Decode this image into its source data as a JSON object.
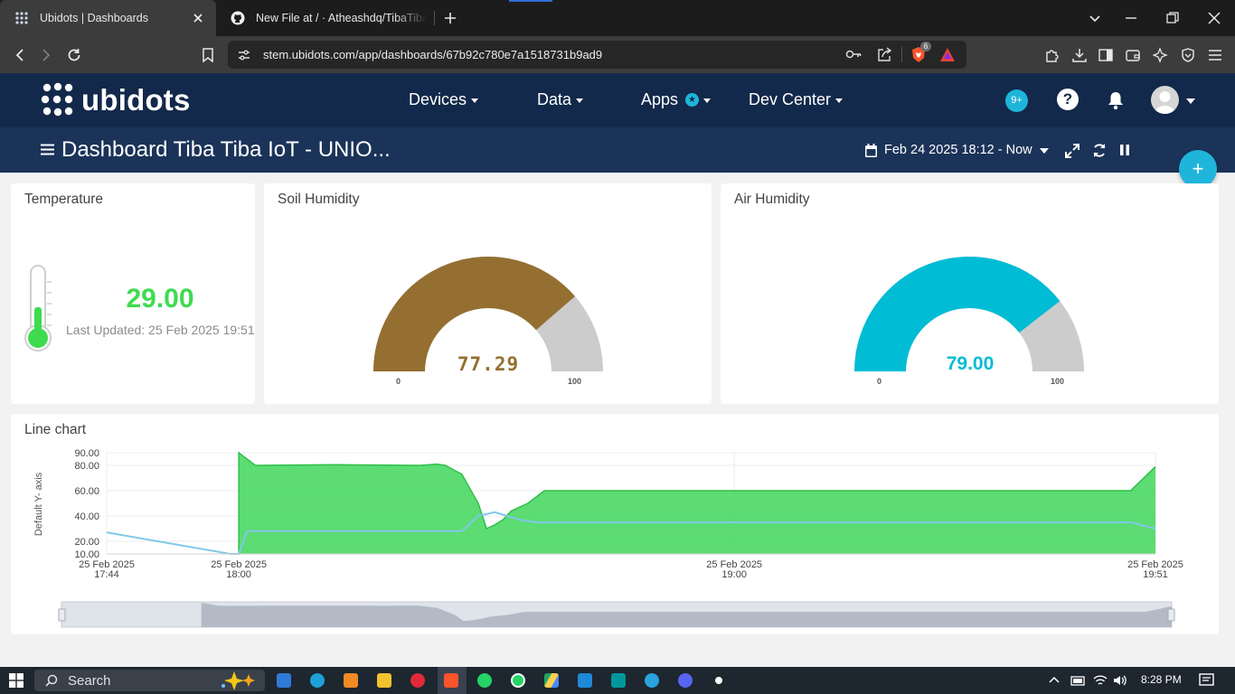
{
  "browser": {
    "tabs": [
      {
        "title": "Ubidots | Dashboards",
        "active": true
      },
      {
        "title": "New File at / · Atheashdq/TibaTibaIoT",
        "active": false
      }
    ],
    "url": "stem.ubidots.com/app/dashboards/67b92c780e7a1518731b9ad9",
    "extension_badge": "6"
  },
  "nav": {
    "logo": "ubidots",
    "items": [
      {
        "label": "Devices"
      },
      {
        "label": "Data"
      },
      {
        "label": "Apps"
      },
      {
        "label": "Dev Center"
      }
    ],
    "notifications_badge": "9+",
    "help": "?"
  },
  "dashboard": {
    "title": "Dashboard Tiba Tiba IoT - UNIO...",
    "date_range": "Feb 24 2025 18:12 - Now",
    "add_button": "+"
  },
  "widgets": {
    "temperature": {
      "title": "Temperature",
      "value": "29.00",
      "last_updated": "Last Updated: 25 Feb 2025 19:51",
      "color": "#3fdb4f"
    },
    "soil": {
      "title": "Soil Humidity",
      "value": "77.29",
      "min": "0",
      "max": "100",
      "level": 77.29,
      "color": "#946f31"
    },
    "air": {
      "title": "Air Humidity",
      "value": "79.00",
      "min": "0",
      "max": "100",
      "level": 79,
      "color": "#00bcd4"
    },
    "line": {
      "title": "Line chart"
    }
  },
  "chart_data": {
    "type": "area",
    "title": "Line chart",
    "ylabel": "Default Y- axis",
    "ylim": [
      10,
      90
    ],
    "yticks": [
      "90.00",
      "80.00",
      "60.00",
      "40.00",
      "20.00",
      "10.00"
    ],
    "xticks": [
      {
        "l1": "25 Feb 2025",
        "l2": "17:44",
        "t": "17:44"
      },
      {
        "l1": "25 Feb 2025",
        "l2": "18:00",
        "t": "18:00"
      },
      {
        "l1": "25 Feb 2025",
        "l2": "19:00",
        "t": "19:00"
      },
      {
        "l1": "25 Feb 2025",
        "l2": "19:51",
        "t": "19:51"
      }
    ],
    "series": [
      {
        "color": "#3fd65a",
        "fill": true,
        "points": [
          [
            "18:00",
            10
          ],
          [
            "18:00",
            90
          ],
          [
            "18:02",
            80
          ],
          [
            "18:12",
            80.5
          ],
          [
            "18:22",
            80
          ],
          [
            "18:24",
            81
          ],
          [
            "18:25",
            80
          ],
          [
            "18:27",
            73
          ],
          [
            "18:29",
            50
          ],
          [
            "18:30",
            30
          ],
          [
            "18:31",
            33
          ],
          [
            "18:32",
            37
          ],
          [
            "18:33",
            44
          ],
          [
            "18:35",
            50
          ],
          [
            "18:37",
            60
          ],
          [
            "19:48",
            60
          ],
          [
            "19:51",
            79
          ]
        ]
      },
      {
        "color": "#80c8e8",
        "fill": false,
        "points": [
          [
            "17:44",
            27
          ],
          [
            "17:59",
            10
          ],
          [
            "18:00",
            10
          ],
          [
            "18:01",
            28
          ],
          [
            "18:27",
            28
          ],
          [
            "18:29",
            40
          ],
          [
            "18:31",
            43
          ],
          [
            "18:34",
            37
          ],
          [
            "18:36",
            35
          ],
          [
            "19:48",
            35
          ],
          [
            "19:51",
            30
          ]
        ]
      }
    ]
  },
  "taskbar": {
    "search_placeholder": "Search",
    "time": "8:28 PM"
  }
}
